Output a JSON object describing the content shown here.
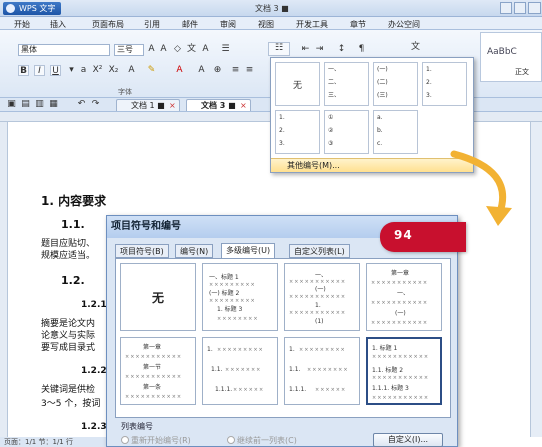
{
  "app": {
    "button_label": "WPS 文字",
    "title": "文档 3 ■"
  },
  "ribbon_tabs": [
    "开始",
    "插入",
    "页面布局",
    "引用",
    "邮件",
    "审阅",
    "视图",
    "开发工具",
    "章节",
    "办公空间"
  ],
  "ribbon": {
    "font_name": "黑体",
    "font_size": "三号",
    "group_font_label": "字体",
    "styles_preview": "AaBbC",
    "styles_caption": "正文"
  },
  "doc_tabs": [
    {
      "label": "文档 1 ■",
      "active": false
    },
    {
      "label": "文档 3 ■",
      "active": true
    }
  ],
  "document": {
    "h1": "1.  内容要求",
    "h2_1": "1.1.",
    "p1": "题目应贴切、",
    "p2": "规模应适当。",
    "h2_2": "1.2.",
    "h3_1": "1.2.1",
    "p3": "摘要是论文内",
    "p4": "论意义与实际",
    "p5": "要写成目录式",
    "h3_2": "1.2.2",
    "p6": "关键词是供检",
    "p7": "3～5 个，按词",
    "h3_3": "1.2.3"
  },
  "statusbar": {
    "text": "页面：1/1   节：1/1   行"
  },
  "numbering_popup": {
    "none_label": "无",
    "more_label": "其他编号(M)...",
    "cells": [
      {
        "lines": [
          "一、",
          "二、",
          "三、"
        ]
      },
      {
        "lines": [
          "(一)",
          "(二)",
          "(三)"
        ]
      },
      {
        "lines": [
          "1.",
          "2.",
          "3."
        ]
      },
      {
        "lines": [
          "1.",
          "2.",
          "3."
        ]
      },
      {
        "lines": [
          "①",
          "②",
          "③"
        ]
      },
      {
        "lines": [
          "a.",
          "b.",
          "c."
        ]
      }
    ]
  },
  "dialog": {
    "title": "项目符号和编号",
    "tabs": [
      "项目符号(B)",
      "编号(N)",
      "多级编号(U)",
      "自定义列表(L)"
    ],
    "active_tab": 2,
    "none_label": "无",
    "cells": [
      {
        "lines": [
          "一、标题 1",
          "(一) 标题 2",
          "1. 标题 3"
        ]
      },
      {
        "lines": [
          "一、",
          "(一)",
          "1.",
          "(1)"
        ]
      },
      {
        "lines": [
          "第一章",
          "一、",
          "(一)"
        ]
      },
      {
        "lines": [
          "第一章",
          "第一节",
          "第一条"
        ]
      },
      {
        "lines": [
          "1.",
          "1.1.",
          "1.1.1."
        ]
      },
      {
        "lines": [
          "1.",
          "1.1.",
          "1.1.1."
        ]
      },
      {
        "lines": [
          "1. 标题 1",
          "1.1. 标题 2",
          "1.1.1. 标题 3"
        ]
      }
    ],
    "list_number_label": "列表编号",
    "radio_restart": "重新开始编号(R)",
    "radio_continue": "继续前一列表(C)",
    "custom_button": "自定义(I)..."
  },
  "banner": {
    "text": "94"
  }
}
